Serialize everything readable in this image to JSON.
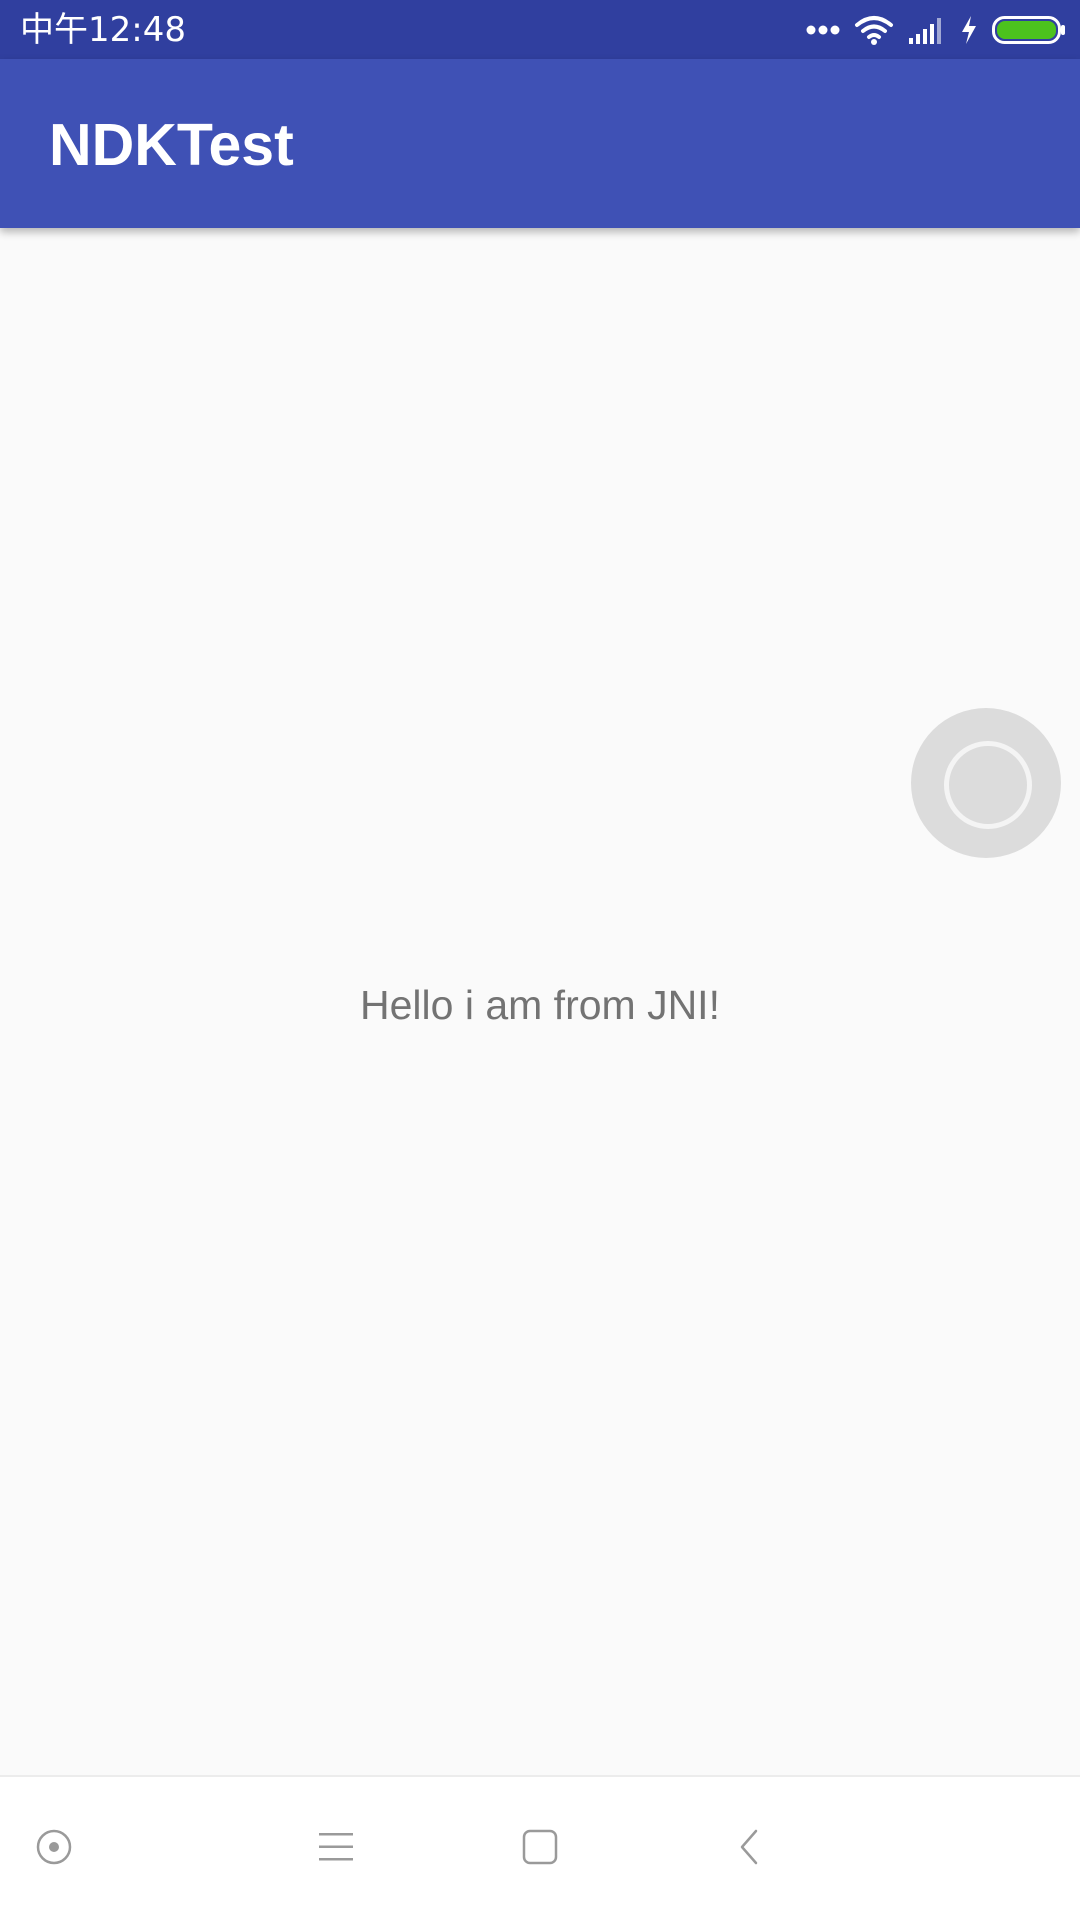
{
  "status_bar": {
    "time": "中午12:48",
    "icons": [
      "more-dots-icon",
      "wifi-icon",
      "signal-icon",
      "charging-bolt-icon",
      "battery-icon"
    ],
    "battery_color": "#4cc21d",
    "background": "#303f9f"
  },
  "app_bar": {
    "title": "NDKTest",
    "background": "#3f51b5"
  },
  "main": {
    "message": "Hello i am from JNI!"
  },
  "floating_ball": {
    "icon": "assistive-ball-icon"
  },
  "nav_bar": {
    "buttons": [
      "screen-record-icon",
      "menu-icon",
      "home-icon",
      "back-icon"
    ]
  }
}
